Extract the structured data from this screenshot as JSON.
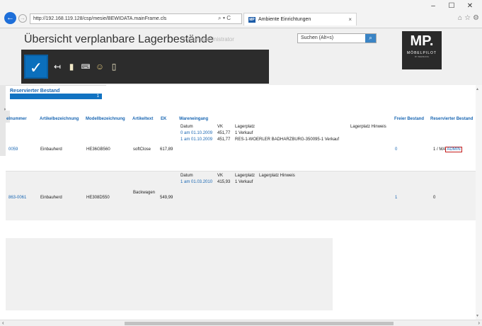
{
  "browser": {
    "url": "http://192.168.119.128/csp/mesie/BEWIDATA.mainFrame.cls",
    "address_controls": "⌕ ▾ C",
    "tab_label": "Ambiente Einrichtungen",
    "favicon_text": "MP",
    "tab_close": "×",
    "window_controls": [
      "–",
      "☐",
      "✕"
    ]
  },
  "header": {
    "title": "Übersicht verplanbare Lagerbestände",
    "user": "Systemadministrator",
    "search_placeholder": "Suchen (Alt+s)",
    "logo_main": "MP.",
    "logo_sub": "MÖBELPILOT",
    "logo_small": "BY BEWIDATA"
  },
  "toolbar": {
    "icons": [
      "check-icon",
      "back-icon",
      "document-icon",
      "keyboard-icon",
      "user-check-icon",
      "document-arrow-icon"
    ]
  },
  "reserve_panel": {
    "title": "Reservierter Bestand",
    "value": "1"
  },
  "table": {
    "headers": {
      "artikelnummer": "elnummer",
      "bezeichnung": "Artikelbezeichnung",
      "modell": "Modellbezeichnung",
      "text": "Artikeltext",
      "ek": "EK",
      "wareneingang": "Wareneingang",
      "frei": "Freier Bestand",
      "reserviert": "Reservierter Bestand"
    },
    "rows": [
      {
        "artikelnummer": "0059",
        "bezeichnung": "Einbauherd",
        "modell": "HE36GB560",
        "text": "softClose",
        "ek": "617,89",
        "sub_headers": {
          "datum": "Datum",
          "vk": "VK",
          "lagerplatz": "Lagerplatz",
          "hinweis": "Lagerplatz Hinweis"
        },
        "entries": [
          {
            "datum": "0 am 01.10.2009",
            "vk": "451,77",
            "lagerplatz": "1 Verkauf"
          },
          {
            "datum": "1 am 01.10.2009",
            "vk": "451,77",
            "lagerplatz": "RES-1-WOERLER BADHARZBURG-350095-1 Verkauf"
          }
        ],
        "frei": "0",
        "reserviert_prefix": "1 / MA",
        "reserviert_user": "ADMIN"
      },
      {
        "artikelnummer": "863-0061",
        "bezeichnung": "Einbauherd",
        "modell": "HE308D550",
        "text": "Backwagen",
        "ek": "549,99",
        "sub_headers": {
          "datum": "Datum",
          "vk": "VK",
          "lagerplatz": "Lagerplatz",
          "hinweis": "Lagerplatz Hinweis"
        },
        "entries": [
          {
            "datum": "1 am 01.03.2010",
            "vk": "415,93",
            "lagerplatz": "1 Verkauf"
          }
        ],
        "frei": "1",
        "reserviert": "0"
      }
    ]
  }
}
